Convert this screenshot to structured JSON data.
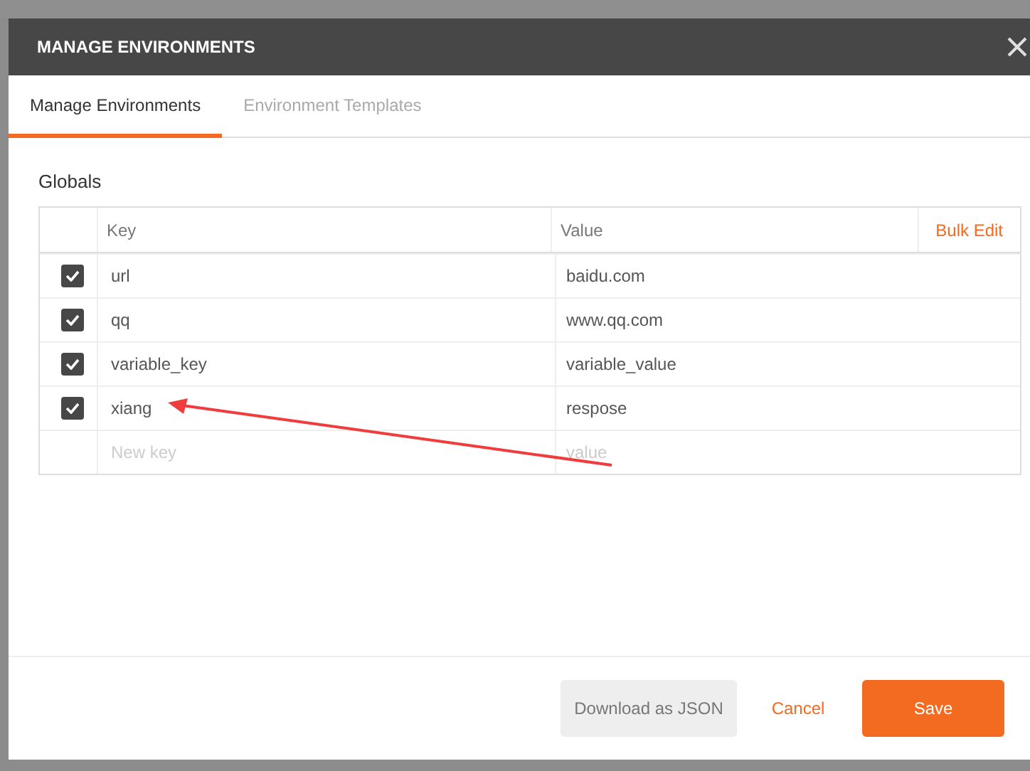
{
  "dialog": {
    "title": "MANAGE ENVIRONMENTS"
  },
  "tabs": [
    {
      "label": "Manage Environments",
      "selected": true
    },
    {
      "label": "Environment Templates",
      "selected": false
    }
  ],
  "section_title": "Globals",
  "table": {
    "columns": [
      "Key",
      "Value"
    ],
    "bulk_edit": "Bulk Edit",
    "rows": [
      {
        "key": "url",
        "value": "baidu.com",
        "checked": true
      },
      {
        "key": "qq",
        "value": "www.qq.com",
        "checked": true
      },
      {
        "key": "variable_key",
        "value": "variable_value",
        "checked": true
      },
      {
        "key": "xiang",
        "value": "respose",
        "checked": true
      }
    ],
    "new_row": {
      "key_placeholder": "New key",
      "value_placeholder": "value"
    }
  },
  "buttons": {
    "download": "Download as JSON",
    "cancel": "Cancel",
    "save": "Save"
  }
}
